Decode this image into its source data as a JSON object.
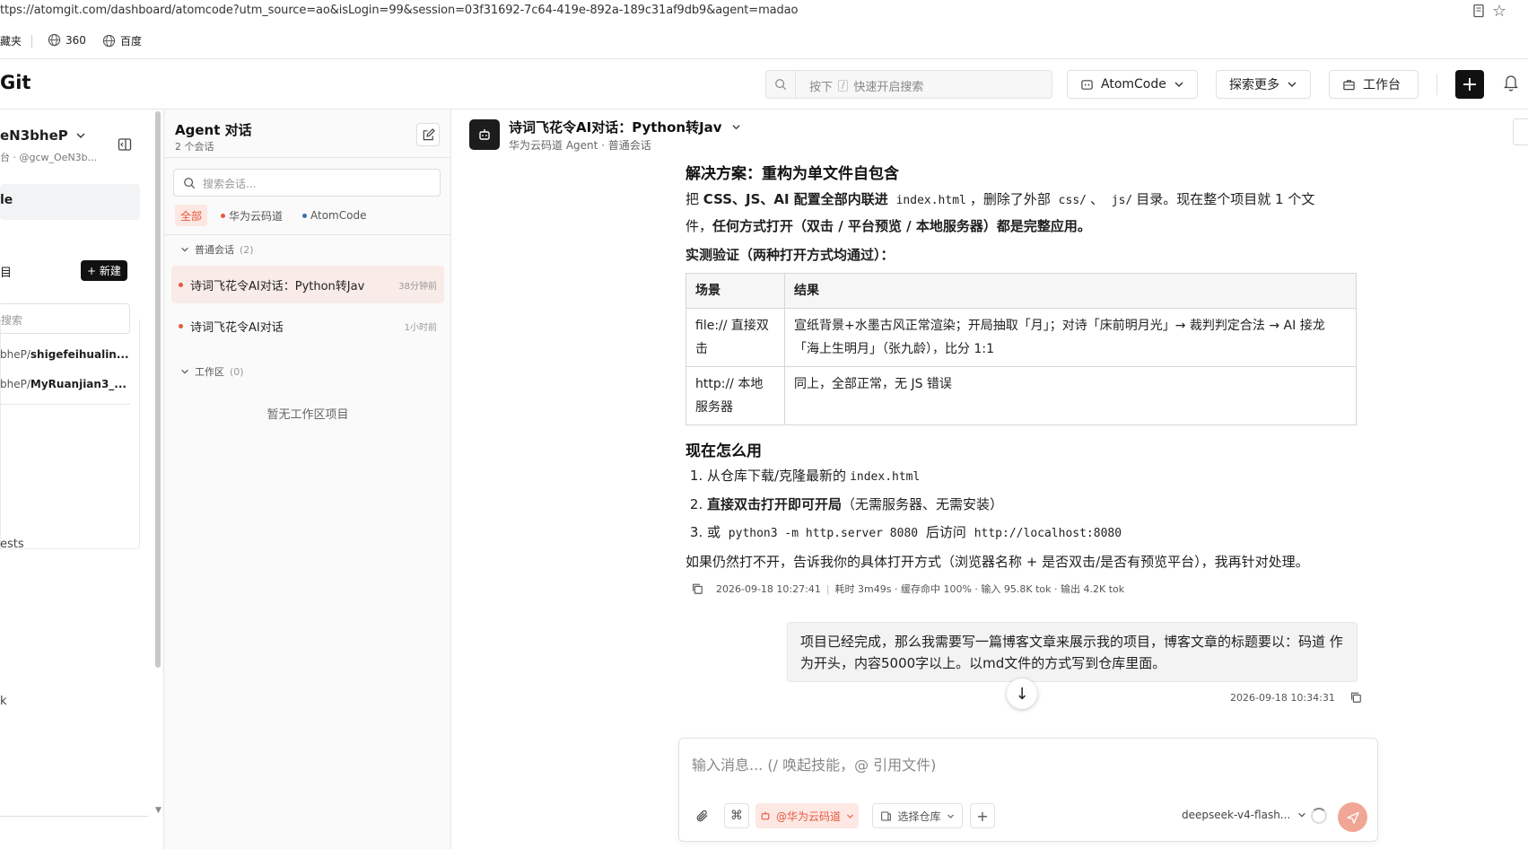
{
  "browser": {
    "url": "ttps://atomgit.com/dashboard/atomcode?utm_source=ao&isLogin=99&session=03f31692-7c64-419e-892a-189c31af9db9&agent=madao",
    "bookmarks": [
      "藏夹",
      "360",
      "百度"
    ]
  },
  "header": {
    "logo": "Git",
    "search_placeholder": "按下",
    "search_key": "/",
    "search_hint": "快速开启搜索",
    "atomcode_label": "AtomCode",
    "explore_label": "探索更多",
    "workbench_label": "工作台"
  },
  "sidebar": {
    "user_name": "eN3bheP",
    "user_handle": "台 · @gcw_OeN3b...",
    "active_item": "le",
    "repos_label": "目",
    "new_label": "+ 新建",
    "search_placeholder": "搜索",
    "repos": [
      {
        "prefix": "bheP/",
        "name": "shigefeihualin..."
      },
      {
        "prefix": "bheP/",
        "name": "MyRuanjian3_..."
      }
    ],
    "item_ests": "ests",
    "item_k": "k"
  },
  "convlist": {
    "title": "Agent 对话",
    "subtitle": "2 个会话",
    "search_placeholder": "搜索会话...",
    "filters": [
      {
        "label": "全部",
        "color": ""
      },
      {
        "label": "华为云码道",
        "color": "#e45a3c"
      },
      {
        "label": "AtomCode",
        "color": "#3a6fb0"
      }
    ],
    "section_normal": "普通会话",
    "section_normal_count": "(2)",
    "conversations": [
      {
        "name": "诗词飞花令AI对话：Python转Jav",
        "time": "38分钟前"
      },
      {
        "name": "诗词飞花令AI对话",
        "time": "1小时前"
      }
    ],
    "section_workspace": "工作区",
    "section_workspace_count": "(0)",
    "empty_workspace": "暂无工作区项目"
  },
  "chat": {
    "title": "诗词飞花令AI对话：Python转Jav",
    "subtitle": "华为云码道 Agent · 普通会话",
    "heading_solution": "解决方案：重构为单文件自包含",
    "para1_a": "把 ",
    "para1_b": "CSS、JS、AI 配置全部内联进",
    "para1_code1": "index.html",
    "para1_c": "，删除了外部",
    "para1_code2": "css/",
    "para1_d": "、",
    "para1_code3": "js/",
    "para1_e": "目录。现在整个项目就 1 个文",
    "para1_f": "件，",
    "para1_g": "任何方式打开（双击 / 平台预览 / 本地服务器）都是完整应用。",
    "verify_heading": "实测验证（两种打开方式均通过）：",
    "table_headers": [
      "场景",
      "结果"
    ],
    "table_rows": [
      [
        "file:// 直接双击",
        "宣纸背景+水墨古风正常渲染；开局抽取「月」；对诗「床前明月光」→ 裁判判定合法 → AI 接龙「海上生明月」（张九龄），比分 1:1"
      ],
      [
        "http:// 本地服务器",
        "同上，全部正常，无 JS 错误"
      ]
    ],
    "howto_heading": "现在怎么用",
    "step1_text": "从仓库下载/克隆最新的",
    "step1_code": "index.html",
    "step2_bold": "直接双击打开即可开局",
    "step2_text": "（无需服务器、无需安装）",
    "step3_a": "或",
    "step3_code1": "python3 -m http.server 8080",
    "step3_b": "后访问",
    "step3_code2": "http://localhost:8080",
    "closing": "如果仍然打不开，告诉我你的具体打开方式（浏览器名称 + 是否双击/是否有预览平台），我再针对处理。",
    "meta_time": "2026-09-18 10:27:41",
    "meta_stats": "耗时 3m49s · 缓存命中 100% · 输入 95.8K tok · 输出 4.2K tok",
    "user_message": "项目已经完成，那么我需要写一篇博客文章来展示我的项目，博客文章的标题要以：码道 作为开头，内容5000字以上。以md文件的方式写到仓库里面。",
    "user_time": "2026-09-18 10:34:31"
  },
  "composer": {
    "placeholder": "输入消息...   (/ 唤起技能，@ 引用文件)",
    "repo_chip": "@华为云码道",
    "select_repo": "选择仓库",
    "model": "deepseek-v4-flash..."
  },
  "colors": {
    "accent": "#e45a3c",
    "send_button": "#f1a594",
    "active_conversation": "#f8ebe8"
  }
}
